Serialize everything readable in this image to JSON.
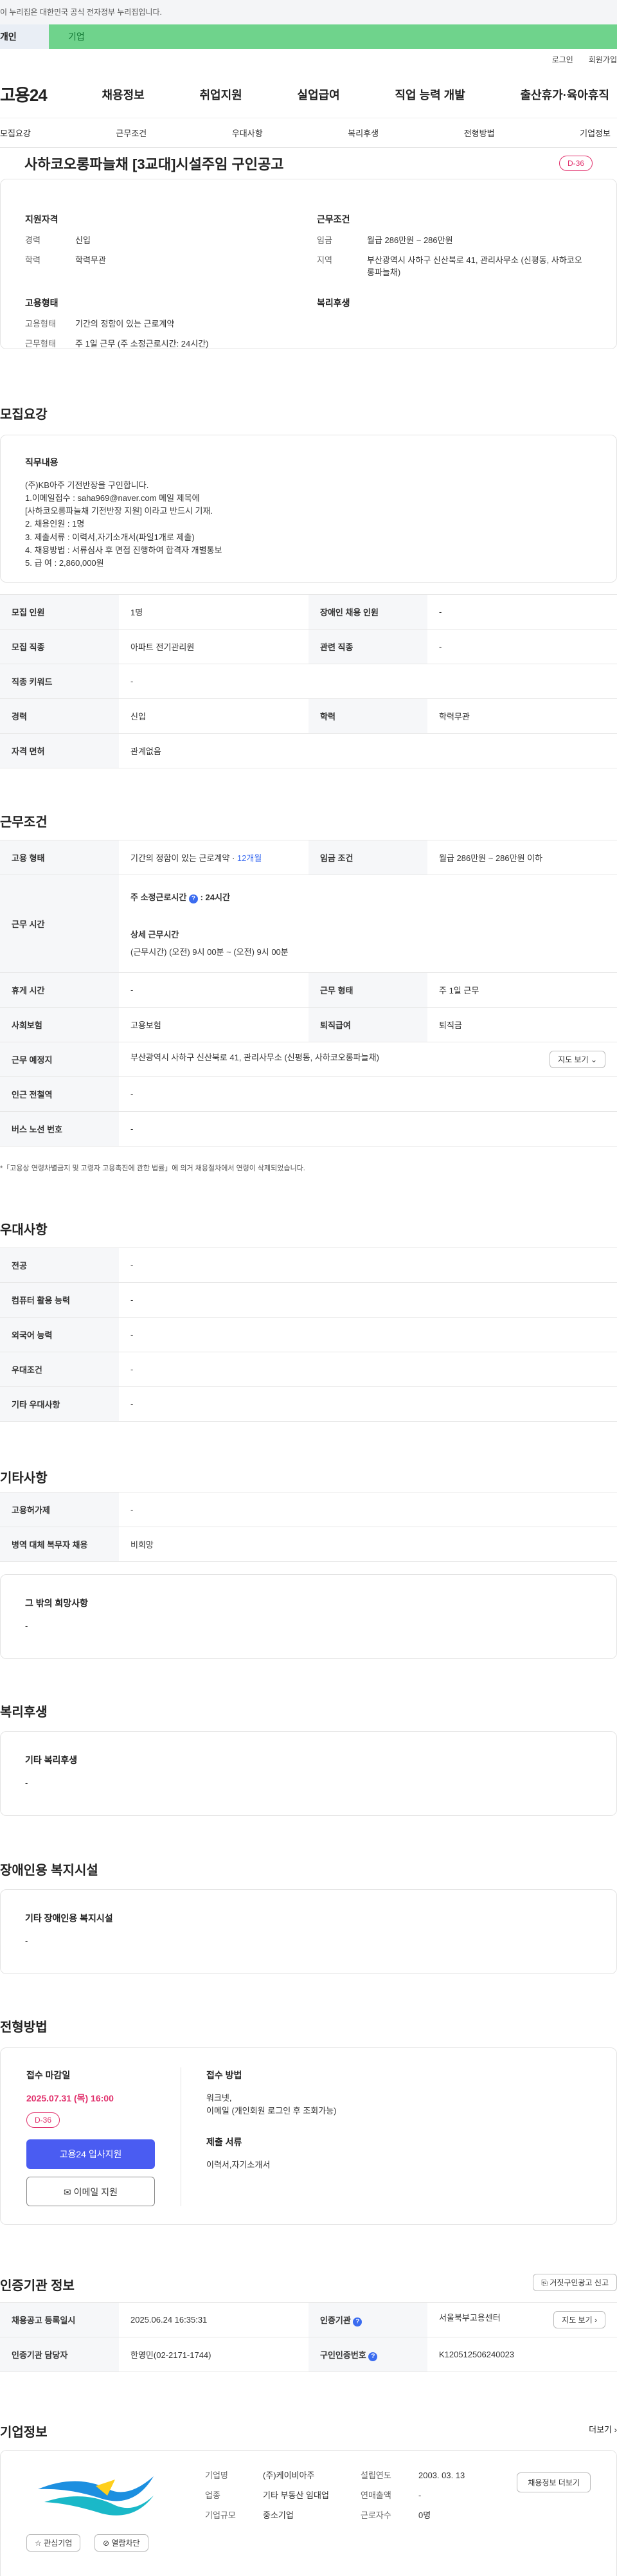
{
  "gov_notice": "이 누리집은 대한민국 공식 전자정부 누리집입니다.",
  "top_tabs": [
    "개인",
    "기업"
  ],
  "util_links": [
    "로그인",
    "회원가입"
  ],
  "gnb": {
    "logo": "고용24",
    "menu": [
      "채용정보",
      "취업지원",
      "실업급여",
      "직업 능력 개발",
      "출산휴가·육아휴직"
    ]
  },
  "subnav": [
    "모집요강",
    "근무조건",
    "우대사항",
    "복리후생",
    "전형방법",
    "기업정보"
  ],
  "job": {
    "title": "사하코오롱파늘채 [3교대]시설주임 구인공고",
    "dday": "D-36"
  },
  "summary": {
    "qualification_title": "지원자격",
    "career_label": "경력",
    "career": "신입",
    "edu_label": "학력",
    "edu": "학력무관",
    "emp_title": "고용형태",
    "emp_type_label": "고용형태",
    "emp_type": "기간의 정함이 있는 근로계약",
    "work_type_label": "근무형태",
    "work_type": "주 1일 근무 (주 소정근로시간: 24시간)",
    "cond_title": "근무조건",
    "wage_label": "임금",
    "wage": "월급 286만원 ~ 286만원",
    "region_label": "지역",
    "region": "부산광역시 사하구 신산북로 41, 관리사무소 (신평동, 사하코오롱파늘채)",
    "welfare_title": "복리후생"
  },
  "recruit": {
    "section_title": "모집요강",
    "duty_title": "직무내용",
    "duty_text": "(주)KB아주 기전반장을 구인합니다.\n1.이메일접수 : saha969@naver.com  메일 제목에\n   [사하코오롱파늘채 기전반장 지원]  이라고 반드시 기재.\n2. 채용인원 : 1명\n3. 제출서류 : 이력서,자기소개서(파일1개로 제출)\n4. 채용방법 : 서류심사 후 면접 진행하여 합격자 개별통보\n5. 급      여 : 2,860,000원",
    "rows": [
      {
        "h1": "모집 인원",
        "v1": "1명",
        "h2": "장애인 채용 인원",
        "v2": "-"
      },
      {
        "h1": "모집 직종",
        "v1": "아파트 전기관리원",
        "h2": "관련 직종",
        "v2": "-"
      },
      {
        "h1": "직종 키워드",
        "v1": "-"
      },
      {
        "h1": "경력",
        "v1": "신입",
        "h2": "학력",
        "v2": "학력무관"
      },
      {
        "h1": "자격 면허",
        "v1": "관계없음"
      }
    ]
  },
  "conditions": {
    "section_title": "근무조건",
    "emp_type_h": "고용 형태",
    "emp_type_v": "기간의 정함이 있는 근로계약 · ",
    "emp_type_period": "12개월",
    "wage_h": "임금 조건",
    "wage_v": "월급 286만원 ~ 286만원 이하",
    "hours_h": "근무 시간",
    "hours_title": "주 소정근로시간",
    "hours_value": ": 24시간",
    "hours_detail_title": "상세 근무시간",
    "hours_detail": "(근무시간) (오전) 9시 00분 ~ (오전) 9시 00분",
    "break_h": "휴게 시간",
    "break_v": "-",
    "work_form_h": "근무 형태",
    "work_form_v": "주 1일 근무",
    "insurance_h": "사회보험",
    "insurance_v": "고용보험",
    "severance_h": "퇴직급여",
    "severance_v": "퇴직금",
    "place_h": "근무 예정지",
    "place_v": "부산광역시 사하구 신산북로 41, 관리사무소 (신평동, 사하코오롱파늘채)",
    "map_btn": "지도 보기",
    "station_h": "인근 전철역",
    "station_v": "-",
    "bus_h": "버스 노선 번호",
    "bus_v": "-",
    "note": "*「고용상 연령차별금지 및 고령자 고용촉진에 관한 법률」에 의거 채용절차에서 연령이 삭제되었습니다."
  },
  "preferences": {
    "section_title": "우대사항",
    "rows": [
      {
        "h": "전공",
        "v": "-"
      },
      {
        "h": "컴퓨터 활용 능력",
        "v": "-"
      },
      {
        "h": "외국어 능력",
        "v": "-"
      },
      {
        "h": "우대조건",
        "v": "-"
      },
      {
        "h": "기타 우대사항",
        "v": "-"
      }
    ]
  },
  "other": {
    "section_title": "기타사항",
    "rows": [
      {
        "h": "고용허가제",
        "v": "-"
      },
      {
        "h": "병역 대체 복무자 채용",
        "v": "비희망"
      }
    ],
    "wish_title": "그 밖의 희망사항",
    "wish_value": "-"
  },
  "welfare": {
    "section_title": "복리후생",
    "box_title": "기타 복리후생",
    "box_value": "-"
  },
  "disability": {
    "section_title": "장애인용 복지시설",
    "box_title": "기타 장애인용 복지시설",
    "box_value": "-"
  },
  "process": {
    "section_title": "전형방법",
    "deadline_title": "접수 마감일",
    "deadline": "2025.07.31 (목) 16:00",
    "dday": "D-36",
    "apply_btn": "고용24 입사지원",
    "mail_btn": "이메일 지원",
    "method_title": "접수 방법",
    "method_text": "워크넷,\n이메일 (개인회원 로그인 후 조회가능)",
    "docs_title": "제출 서류",
    "docs_text": "이력서,자기소개서"
  },
  "cert": {
    "section_title": "인증기관 정보",
    "report_btn": "거짓구인광고 신고",
    "reg_h": "채용공고 등록일시",
    "reg_v": "2025.06.24 16:35:31",
    "agency_h": "인증기관",
    "agency_v": "서울북부고용센터",
    "map_btn": "지도 보기",
    "manager_h": "인증기관 담당자",
    "manager_v": "한영민(02-2171-1744)",
    "number_h": "구인인증번호",
    "number_v": "K120512506240023"
  },
  "company": {
    "section_title": "기업정보",
    "more": "더보기",
    "interest_btn": "관심기업",
    "block_btn": "열람차단",
    "name_h": "기업명",
    "name_v": "(주)케이비아주",
    "industry_h": "업종",
    "industry_v": "기타 부동산 임대업",
    "size_h": "기업규모",
    "size_v": "중소기업",
    "founded_h": "설립연도",
    "founded_v": "2003. 03. 13",
    "revenue_h": "연매출액",
    "revenue_v": "-",
    "staff_h": "근로자수",
    "staff_v": "0명",
    "job_list_btn": "채용정보 더보기"
  },
  "colors": {
    "accent_blue": "#4a5cf2",
    "green_tab": "#6fd38c",
    "deadline_red": "#e1306c"
  }
}
